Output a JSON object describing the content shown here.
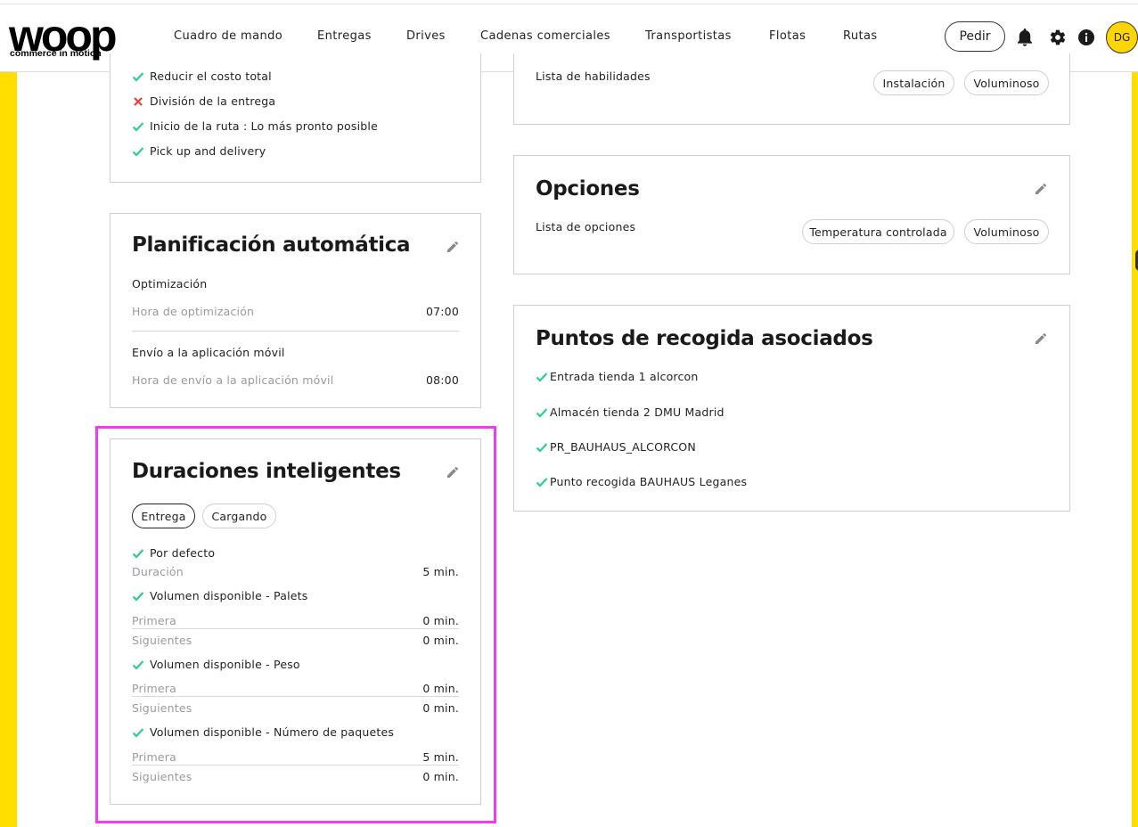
{
  "brand": {
    "logo_text": "woop",
    "tagline": "commerce in motion",
    "accent_color": "#ffd500",
    "highlight_color": "#f03cf0",
    "check_color": "#2ecc8f",
    "cross_color": "#e8403a"
  },
  "nav": {
    "items": [
      {
        "label": "Cuadro de mando"
      },
      {
        "label": "Entregas"
      },
      {
        "label": "Drives"
      },
      {
        "label": "Cadenas comerciales"
      },
      {
        "label": "Transportistas",
        "active": true
      },
      {
        "label": "Flotas"
      },
      {
        "label": "Rutas"
      }
    ],
    "order_button": "Pedir",
    "icons": [
      "bell-icon",
      "gear-icon",
      "info-icon"
    ],
    "avatar_initials": "DG"
  },
  "strategy_card": {
    "lines": [
      {
        "icon": "check",
        "text": "Reducir el costo total"
      },
      {
        "icon": "cross",
        "text": "División de la entrega"
      },
      {
        "icon": "check",
        "text": "Inicio de la ruta : Lo más pronto posible"
      },
      {
        "icon": "check",
        "text": "Pick up and delivery"
      }
    ]
  },
  "skills_card": {
    "label": "Lista de habilidades",
    "chips": [
      "Instalación",
      "Voluminoso"
    ]
  },
  "auto_planning": {
    "title": "Planificación automática",
    "optimization_label": "Optimización",
    "optimization_key": "Hora de optimización",
    "optimization_value": "07:00",
    "mobile_label": "Envío a la aplicación móvil",
    "mobile_key": "Hora de envío a la aplicación móvil",
    "mobile_value": "08:00"
  },
  "options_card": {
    "title": "Opciones",
    "label": "Lista de opciones",
    "chips": [
      "Temperatura controlada",
      "Voluminoso"
    ]
  },
  "pickup_points": {
    "title": "Puntos de recogida asociados",
    "items": [
      "Entrada tienda 1 alcorcon",
      "Almacén tienda 2 DMU Madrid",
      "PR_BAUHAUS_ALCORCON",
      "Punto recogida BAUHAUS Leganes"
    ]
  },
  "smart_durations": {
    "title": "Duraciones inteligentes",
    "tabs": [
      "Entrega",
      "Cargando"
    ],
    "selected_tab": "Entrega",
    "default_label": "Por defecto",
    "duration_key": "Duración",
    "duration_value": "5 min.",
    "groups": [
      {
        "label": "Volumen disponible - Palets",
        "first_key": "Primera",
        "first_value": "0 min.",
        "next_key": "Siguientes",
        "next_value": "0 min."
      },
      {
        "label": "Volumen disponible - Peso",
        "first_key": "Primera",
        "first_value": "0 min.",
        "next_key": "Siguientes",
        "next_value": "0 min."
      },
      {
        "label": "Volumen disponible - Número de paquetes",
        "first_key": "Primera",
        "first_value": "5 min.",
        "next_key": "Siguientes",
        "next_value": "0 min."
      }
    ]
  }
}
